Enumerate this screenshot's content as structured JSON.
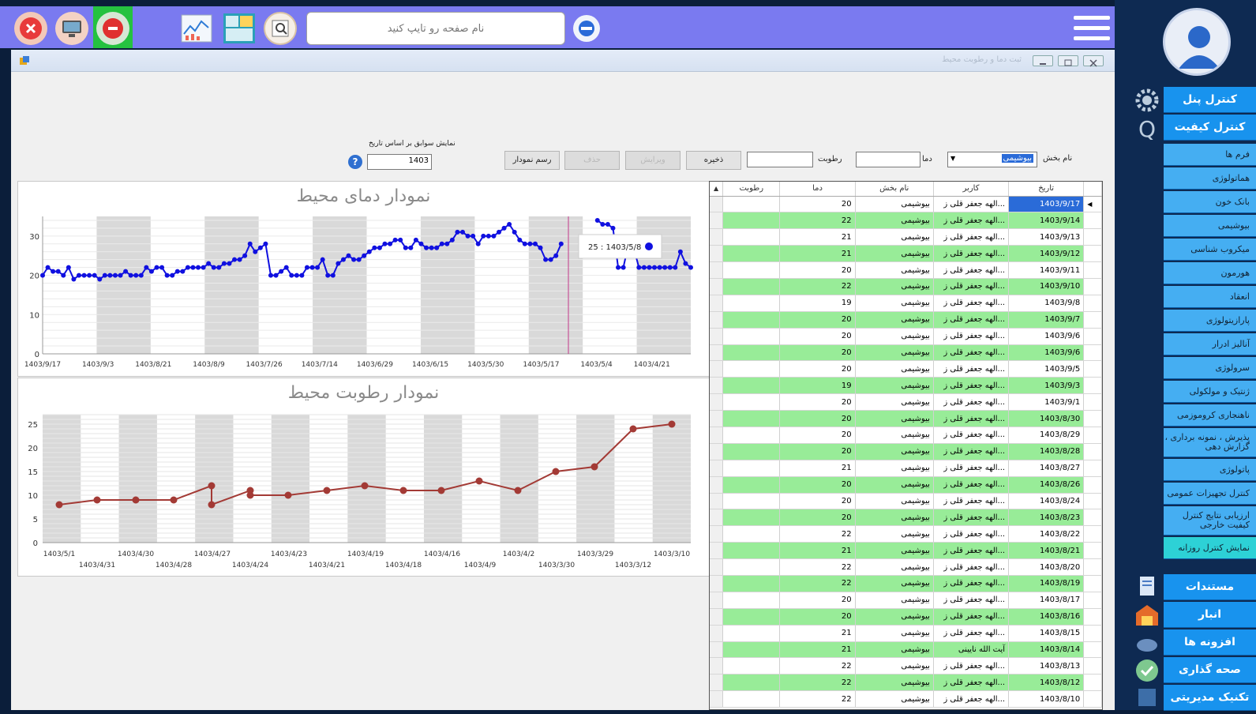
{
  "toolbar": {
    "page_search_placeholder": "نام صفحه رو تایپ کنید"
  },
  "window": {
    "title": "ثبت دما و رطوبت محیط"
  },
  "form": {
    "ward_label": "نام بخش",
    "ward_value": "بیوشیمی",
    "temp_label": "دما",
    "humidity_label": "رطوبت",
    "save_btn": "ذخیره",
    "edit_btn": "ویرایش",
    "delete_btn": "حذف",
    "draw_chart_btn": "رسم نمودار",
    "history_label": "نمایش سوابق بر اساس تاریخ",
    "history_value": "1403"
  },
  "grid": {
    "headers": [
      "تاریخ",
      "کاربر",
      "نام بخش",
      "دما",
      "رطوبت"
    ],
    "rows": [
      {
        "date": "1403/9/17",
        "user": "الهه جعفر قلی ز...",
        "ward": "بیوشیمی",
        "temp": "20"
      },
      {
        "date": "1403/9/14",
        "user": "الهه جعفر قلی ز...",
        "ward": "بیوشیمی",
        "temp": "22"
      },
      {
        "date": "1403/9/13",
        "user": "الهه جعفر قلی ز...",
        "ward": "بیوشیمی",
        "temp": "21"
      },
      {
        "date": "1403/9/12",
        "user": "الهه جعفر قلی ز...",
        "ward": "بیوشیمی",
        "temp": "21"
      },
      {
        "date": "1403/9/11",
        "user": "الهه جعفر قلی ز...",
        "ward": "بیوشیمی",
        "temp": "20"
      },
      {
        "date": "1403/9/10",
        "user": "الهه جعفر قلی ز...",
        "ward": "بیوشیمی",
        "temp": "22"
      },
      {
        "date": "1403/9/8",
        "user": "الهه جعفر قلی ز...",
        "ward": "بیوشیمی",
        "temp": "19"
      },
      {
        "date": "1403/9/7",
        "user": "الهه جعفر قلی ز...",
        "ward": "بیوشیمی",
        "temp": "20"
      },
      {
        "date": "1403/9/6",
        "user": "الهه جعفر قلی ز...",
        "ward": "بیوشیمی",
        "temp": "20"
      },
      {
        "date": "1403/9/6",
        "user": "الهه جعفر قلی ز...",
        "ward": "بیوشیمی",
        "temp": "20"
      },
      {
        "date": "1403/9/5",
        "user": "الهه جعفر قلی ز...",
        "ward": "بیوشیمی",
        "temp": "20"
      },
      {
        "date": "1403/9/3",
        "user": "الهه جعفر قلی ز...",
        "ward": "بیوشیمی",
        "temp": "19"
      },
      {
        "date": "1403/9/1",
        "user": "الهه جعفر قلی ز...",
        "ward": "بیوشیمی",
        "temp": "20"
      },
      {
        "date": "1403/8/30",
        "user": "الهه جعفر قلی ز...",
        "ward": "بیوشیمی",
        "temp": "20"
      },
      {
        "date": "1403/8/29",
        "user": "الهه جعفر قلی ز...",
        "ward": "بیوشیمی",
        "temp": "20"
      },
      {
        "date": "1403/8/28",
        "user": "الهه جعفر قلی ز...",
        "ward": "بیوشیمی",
        "temp": "20"
      },
      {
        "date": "1403/8/27",
        "user": "الهه جعفر قلی ز...",
        "ward": "بیوشیمی",
        "temp": "21"
      },
      {
        "date": "1403/8/26",
        "user": "الهه جعفر قلی ز...",
        "ward": "بیوشیمی",
        "temp": "20"
      },
      {
        "date": "1403/8/24",
        "user": "الهه جعفر قلی ز...",
        "ward": "بیوشیمی",
        "temp": "20"
      },
      {
        "date": "1403/8/23",
        "user": "الهه جعفر قلی ز...",
        "ward": "بیوشیمی",
        "temp": "20"
      },
      {
        "date": "1403/8/22",
        "user": "الهه جعفر قلی ز...",
        "ward": "بیوشیمی",
        "temp": "22"
      },
      {
        "date": "1403/8/21",
        "user": "الهه جعفر قلی ز...",
        "ward": "بیوشیمی",
        "temp": "21"
      },
      {
        "date": "1403/8/20",
        "user": "الهه جعفر قلی ز...",
        "ward": "بیوشیمی",
        "temp": "22"
      },
      {
        "date": "1403/8/19",
        "user": "الهه جعفر قلی ز...",
        "ward": "بیوشیمی",
        "temp": "22"
      },
      {
        "date": "1403/8/17",
        "user": "الهه جعفر قلی ز...",
        "ward": "بیوشیمی",
        "temp": "20"
      },
      {
        "date": "1403/8/16",
        "user": "الهه جعفر قلی ز...",
        "ward": "بیوشیمی",
        "temp": "20"
      },
      {
        "date": "1403/8/15",
        "user": "الهه جعفر قلی ز...",
        "ward": "بیوشیمی",
        "temp": "21"
      },
      {
        "date": "1403/8/14",
        "user": "آیت الله نایینی",
        "ward": "بیوشیمی",
        "temp": "21"
      },
      {
        "date": "1403/8/13",
        "user": "الهه جعفر قلی ز...",
        "ward": "بیوشیمی",
        "temp": "22"
      },
      {
        "date": "1403/8/12",
        "user": "الهه جعفر قلی ز...",
        "ward": "بیوشیمی",
        "temp": "22"
      },
      {
        "date": "1403/8/10",
        "user": "الهه جعفر قلی ز...",
        "ward": "بیوشیمی",
        "temp": "22"
      }
    ]
  },
  "sidebar": {
    "control_panel": "کنترل پنل",
    "quality_control": "کنترل کیفیت",
    "items": [
      "فرم ها",
      "هماتولوژی",
      "بانک خون",
      "بیوشیمی",
      "میکروب شناسی",
      "هورمون",
      "انعقاد",
      "پارازیتولوژی",
      "آنالیز ادرار",
      "سرولوژی",
      "ژنتیک و مولکولی",
      "ناهنجاری کروموزمی",
      "پذیرش ، نمونه برداری ، گزارش دهی",
      "پاتولوژی",
      "کنترل تجهیزات عمومی",
      "ارزیابی نتایج کنترل کیفیت خارجی",
      "نمایش کنترل روزانه"
    ],
    "documents": "مستندات",
    "warehouse": "انبار",
    "plugins": "افزونه ها",
    "page_setup": "صحه گذاری",
    "management": "تکنیک مدیریتی"
  },
  "colors": {
    "temp_series": "#1010e0",
    "humidity_series": "#a33a35",
    "row_highlight": "#98ec98",
    "sidebar": "#1a8fe8"
  },
  "chart_data": [
    {
      "type": "line",
      "title": "نمودار دمای محیط",
      "ylim": [
        0,
        35
      ],
      "yticks": [
        0,
        10,
        20,
        30
      ],
      "xtick_labels": [
        "1403/9/17",
        "1403/9/3",
        "1403/8/21",
        "1403/8/9",
        "1403/7/26",
        "1403/7/14",
        "1403/6/29",
        "1403/6/15",
        "1403/5/30",
        "1403/5/17",
        "1403/5/4",
        "1403/4/21"
      ],
      "values": [
        20,
        22,
        21,
        21,
        20,
        22,
        19,
        20,
        20,
        20,
        20,
        19,
        20,
        20,
        20,
        20,
        21,
        20,
        20,
        20,
        22,
        21,
        22,
        22,
        20,
        20,
        21,
        21,
        22,
        22,
        22,
        22,
        23,
        22,
        22,
        23,
        23,
        24,
        24,
        25,
        28,
        26,
        27,
        28,
        20,
        20,
        21,
        22,
        20,
        20,
        20,
        22,
        22,
        22,
        24,
        20,
        20,
        23,
        24,
        25,
        24,
        24,
        25,
        26,
        27,
        27,
        28,
        28,
        29,
        29,
        27,
        27,
        29,
        28,
        27,
        27,
        27,
        28,
        28,
        29,
        31,
        31,
        30,
        30,
        28,
        30,
        30,
        30,
        31,
        32,
        33,
        31,
        29,
        28,
        28,
        28,
        27,
        24,
        24,
        25,
        28,
        null,
        null,
        null,
        null,
        null,
        null,
        34,
        33,
        33,
        32,
        22,
        22,
        28,
        27,
        22,
        22,
        22,
        22,
        22,
        22,
        22,
        22,
        26,
        23,
        22
      ],
      "tooltip": "25 : 1403/5/8"
    },
    {
      "type": "line",
      "title": "نمودار رطوبت محیط",
      "ylim": [
        0,
        27
      ],
      "yticks": [
        0,
        5,
        10,
        15,
        20,
        25
      ],
      "xtick_labels_top": [
        "1403/5/1",
        "1403/4/30",
        "1403/4/27",
        "1403/4/23",
        "1403/4/19",
        "1403/4/16",
        "1403/4/2",
        "1403/3/29",
        "1403/3/10"
      ],
      "xtick_labels_bottom": [
        "1403/4/31",
        "1403/4/28",
        "1403/4/24",
        "1403/4/21",
        "1403/4/18",
        "1403/4/9",
        "1403/3/30",
        "1403/3/12"
      ],
      "values": [
        8,
        9,
        9,
        9,
        12,
        8,
        11,
        10,
        10,
        11,
        12,
        11,
        11,
        13,
        11,
        15,
        16,
        24,
        25
      ]
    }
  ]
}
